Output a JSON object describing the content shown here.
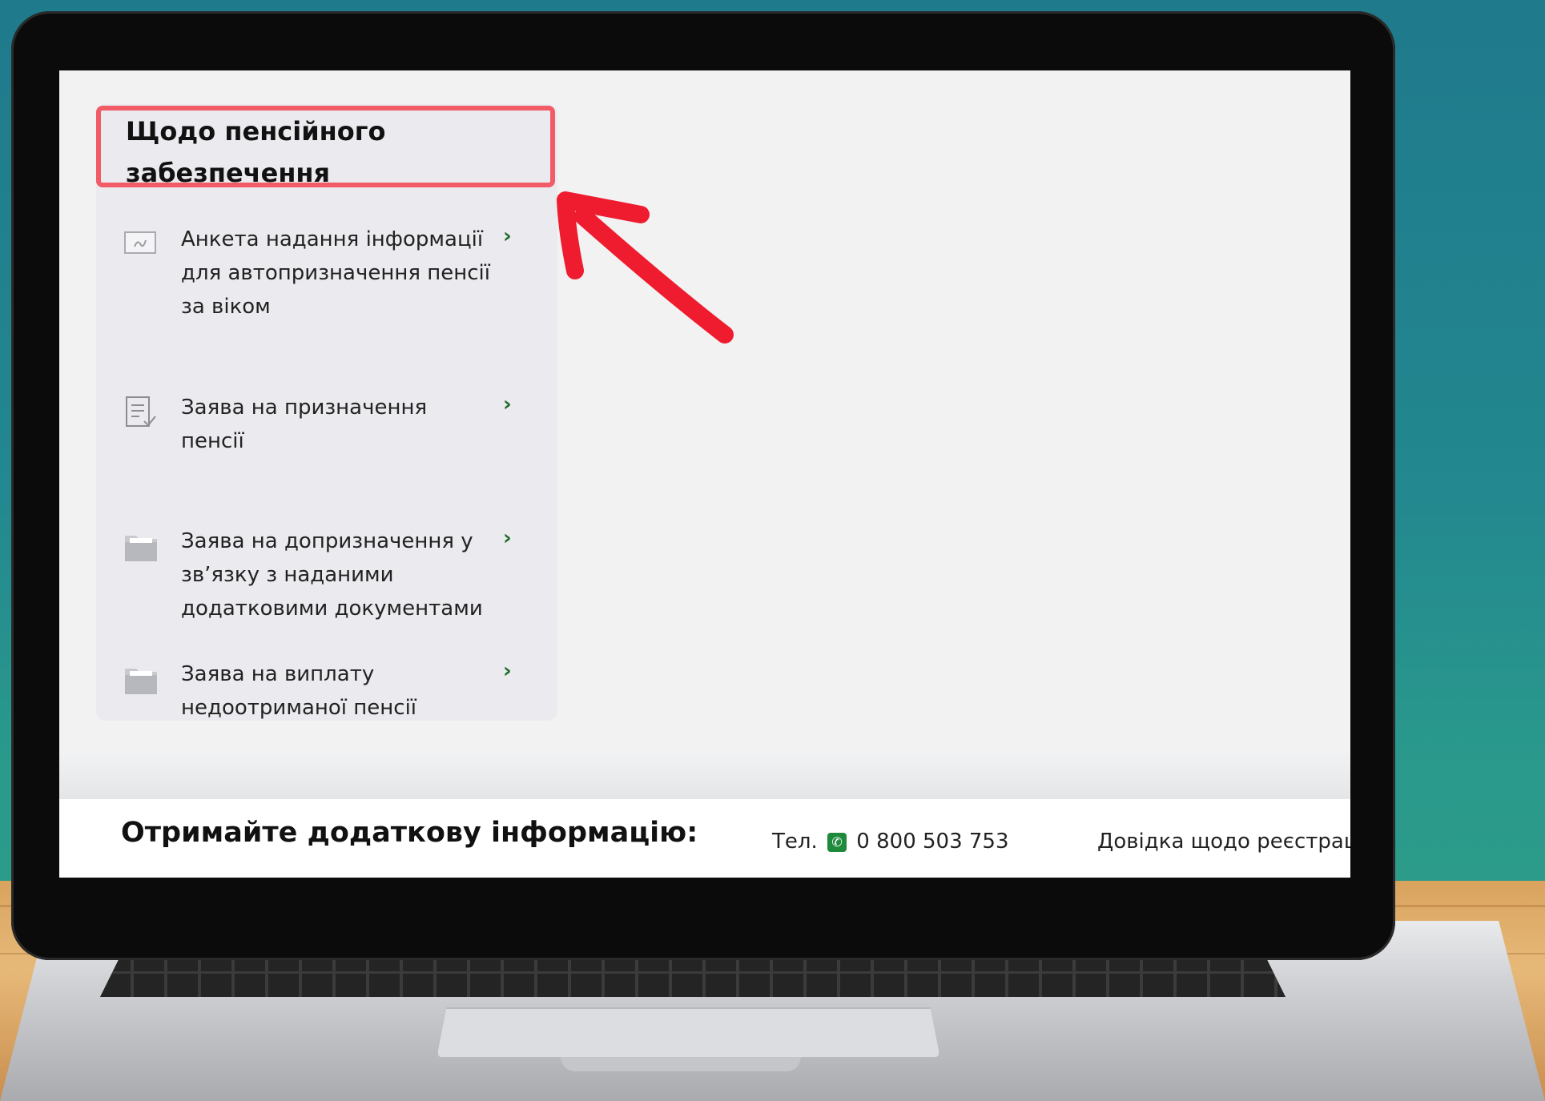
{
  "menu": {
    "title": "Щодо пенсійного забезпечення",
    "items": [
      {
        "label": "Анкета надання інформації для автопризначення пенсії за віком",
        "icon": "signature-form-icon"
      },
      {
        "label": "Заява на призначення пенсії",
        "icon": "checklist-document-icon"
      },
      {
        "label": "Заява на допризначення у зв’язку з наданими додатковими документами",
        "icon": "folder-icon"
      },
      {
        "label": "Заява на виплату недоотриманої пенсії",
        "icon": "folder-icon"
      }
    ],
    "chevron": "›"
  },
  "footer": {
    "title": "Отримайте додаткову інформацію:",
    "phone_prefix": "Тел.",
    "phone_number": "0 800 503 753",
    "help_text": "Довідка щодо реєстрац"
  },
  "colors": {
    "highlight": "#f25c66",
    "arrow": "#ee1c2e",
    "chevron": "#1e6b2a",
    "phone_icon": "#1e8a3b"
  }
}
